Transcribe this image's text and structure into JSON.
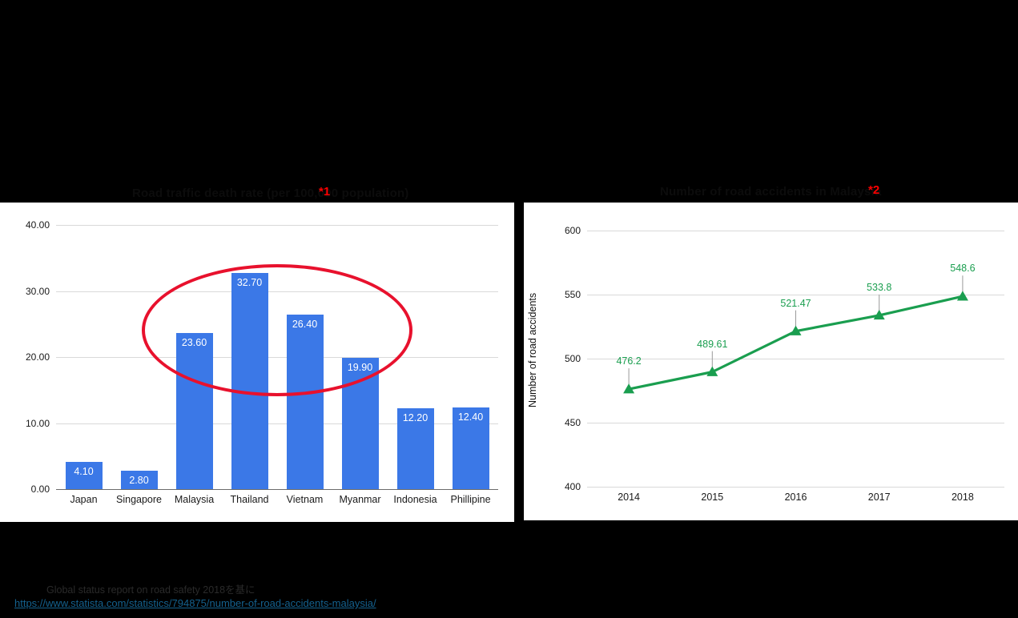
{
  "slide": {
    "background_color": "#000000",
    "heading_left": "Road traffic death rate (per 100,000 population)",
    "heading_right": "Number of road accidents in Malaysia",
    "note_marker_1": "*1",
    "note_marker_2": "*2",
    "note_marker_color": "#FF0000"
  },
  "footer": {
    "source_text": "Global status report on road safety 2018を基に",
    "source_url": "https://www.statista.com/statistics/794875/number-of-road-accidents-malaysia/",
    "link_color": "#14618E"
  },
  "highlight": {
    "shape": "ellipse",
    "color": "#E8112D",
    "covers": [
      "Malaysia",
      "Thailand",
      "Vietnam",
      "Myanmar"
    ]
  },
  "chart_data": [
    {
      "id": "road-death-rate-bar",
      "type": "bar",
      "title": "",
      "xlabel": "",
      "ylabel": "",
      "categories": [
        "Japan",
        "Singapore",
        "Malaysia",
        "Thailand",
        "Vietnam",
        "Myanmar",
        "Indonesia",
        "Phillipine"
      ],
      "values": [
        4.1,
        2.8,
        23.6,
        32.7,
        26.4,
        19.9,
        12.2,
        12.4
      ],
      "value_labels": [
        "4.10",
        "2.80",
        "23.60",
        "32.70",
        "26.40",
        "19.90",
        "12.20",
        "12.40"
      ],
      "ylim": [
        0,
        40
      ],
      "yticks": [
        0,
        10,
        20,
        30,
        40
      ],
      "ytick_labels": [
        "0.00",
        "10.00",
        "20.00",
        "30.00",
        "40.00"
      ],
      "grid": true,
      "legend": "none",
      "bar_color": "#3B78E7",
      "label_color": "#FFFFFF"
    },
    {
      "id": "malaysia-road-accidents-line",
      "type": "line",
      "title": "",
      "xlabel": "",
      "ylabel": "Number of road accidents",
      "categories": [
        "2014",
        "2015",
        "2016",
        "2017",
        "2018"
      ],
      "values": [
        476.2,
        489.61,
        521.47,
        533.8,
        548.6
      ],
      "value_labels": [
        "476.2",
        "489.61",
        "521.47",
        "533.8",
        "548.6"
      ],
      "ylim": [
        400,
        600
      ],
      "yticks": [
        400,
        450,
        500,
        550,
        600
      ],
      "ytick_labels": [
        "400",
        "450",
        "500",
        "550",
        "600"
      ],
      "grid": true,
      "legend": "none",
      "line_color": "#1A9E4F",
      "marker": "triangle",
      "label_color": "#1A9E4F"
    }
  ]
}
